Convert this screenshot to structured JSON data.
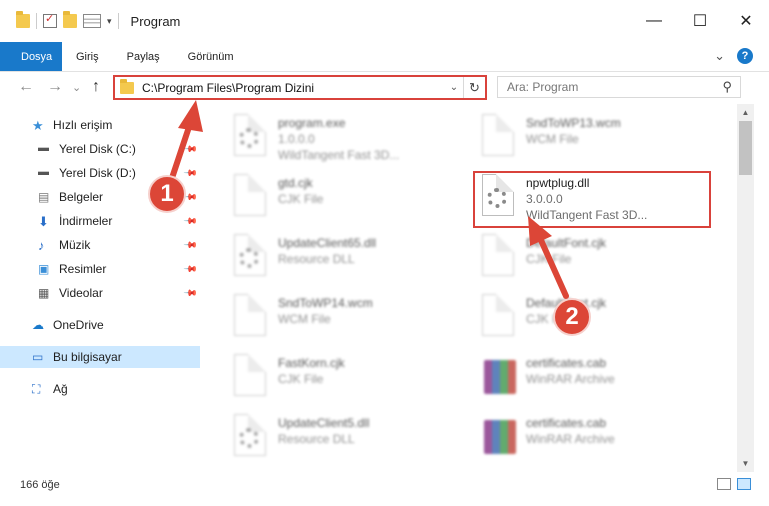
{
  "window": {
    "title": "Program",
    "minimize": "—",
    "maximize": "☐",
    "close": "✕"
  },
  "ribbon": {
    "tabs": [
      "Dosya",
      "Giriş",
      "Paylaş",
      "Görünüm"
    ],
    "expand": "⌄",
    "help": "?"
  },
  "address": {
    "path": "C:\\Program Files\\Program Dizini",
    "search_placeholder": "Ara: Program",
    "back": "←",
    "forward": "→",
    "recent": "⌄",
    "up": "↑",
    "dropdown": "⌄",
    "refresh": "↻"
  },
  "sidebar": {
    "items": [
      {
        "label": "Hızlı erişim",
        "icon": "star-icon"
      },
      {
        "label": "Yerel Disk (C:)",
        "icon": "drive-icon",
        "pinned": true
      },
      {
        "label": "Yerel Disk (D:)",
        "icon": "drive-icon",
        "pinned": true
      },
      {
        "label": "Belgeler",
        "icon": "documents-icon",
        "pinned": true
      },
      {
        "label": "İndirmeler",
        "icon": "downloads-icon",
        "pinned": true
      },
      {
        "label": "Müzik",
        "icon": "music-icon",
        "pinned": true
      },
      {
        "label": "Resimler",
        "icon": "pictures-icon",
        "pinned": true
      },
      {
        "label": "Videolar",
        "icon": "videos-icon",
        "pinned": true
      },
      {
        "label": "OneDrive",
        "icon": "onedrive-icon"
      },
      {
        "label": "Bu bilgisayar",
        "icon": "computer-icon",
        "selected": true
      },
      {
        "label": "Ağ",
        "icon": "network-icon"
      }
    ]
  },
  "files": [
    {
      "name": "program.exe",
      "line2": "1.0.0.0",
      "line3": "WildTangent Fast 3D...",
      "kind": "exe"
    },
    {
      "name": "SndToWP13.wcm",
      "line2": "WCM File",
      "kind": "doc"
    },
    {
      "name": "gtd.cjk",
      "line2": "CJK File",
      "kind": "doc"
    },
    {
      "name": "npwtplug.dll",
      "line2": "3.0.0.0",
      "line3": "WildTangent Fast 3D...",
      "kind": "dll",
      "highlighted": true
    },
    {
      "name": "UpdateClient65.dll",
      "line2": "Resource DLL",
      "kind": "dll"
    },
    {
      "name": "DefaultFont.cjk",
      "line2": "CJK File",
      "kind": "doc"
    },
    {
      "name": "SndToWP14.wcm",
      "line2": "WCM File",
      "kind": "doc"
    },
    {
      "name": "DefaultFont.cjk",
      "line2": "CJK File",
      "kind": "doc"
    },
    {
      "name": "FastKorn.cjk",
      "line2": "CJK File",
      "kind": "doc"
    },
    {
      "name": "certificates.cab",
      "line2": "WinRAR Archive",
      "kind": "rar"
    },
    {
      "name": "UpdateClient5.dll",
      "line2": "Resource DLL",
      "kind": "dll"
    },
    {
      "name": "certificates.cab",
      "line2": "WinRAR Archive",
      "kind": "rar"
    }
  ],
  "status": {
    "count": "166 öğe"
  },
  "annotations": {
    "step1": "1",
    "step2": "2",
    "color": "#dc4637"
  }
}
